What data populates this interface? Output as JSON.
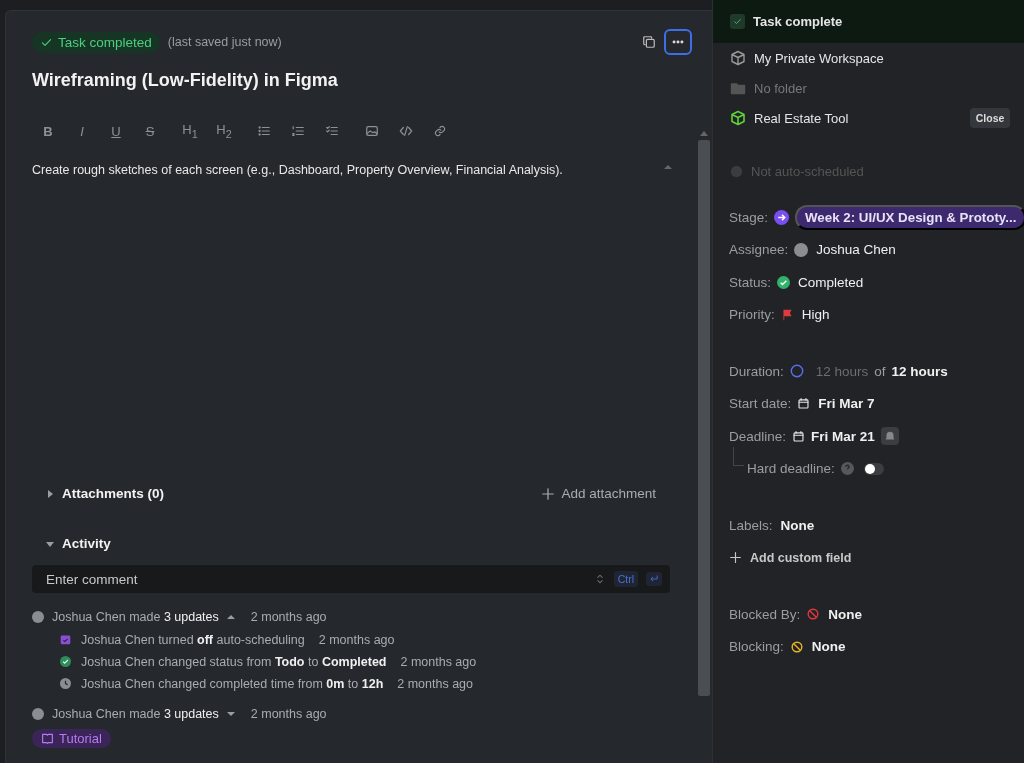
{
  "task": {
    "status_badge": "Task completed",
    "save_note": "(last saved just now)",
    "title": "Wireframing (Low-Fidelity) in Figma"
  },
  "toolbar": [
    {
      "kind": "bold",
      "label": "B"
    },
    {
      "kind": "italic",
      "label": "I"
    },
    {
      "kind": "underline",
      "label": "U"
    },
    {
      "kind": "strike",
      "label": "S"
    },
    {
      "kind": "heading",
      "label": "H$_{1}$"
    },
    {
      "kind": "heading",
      "label": "H$_{2}$"
    },
    {
      "kind": "bullets"
    },
    {
      "kind": "numbers"
    },
    {
      "kind": "checklist"
    },
    {
      "kind": "image"
    },
    {
      "kind": "code"
    },
    {
      "kind": "link"
    }
  ],
  "description": "Create rough sketches of each screen (e.g., Dashboard, Property Overview, Financial Analysis).",
  "sections": [
    {
      "title": "Attachments (0)",
      "expanded": false,
      "action": "Add attachment"
    },
    {
      "title": "Activity",
      "expanded": true
    }
  ],
  "comment": {
    "placeholder": "Enter comment",
    "shortcut": "Ctrl"
  },
  "activity": [
    {
      "summary": "Joshua Chen made **3 updates**",
      "expanded": true,
      "time": "2 months ago",
      "items": [
        {
          "kind": "schedule",
          "text": "Joshua Chen turned **off** auto-scheduling",
          "time": "2 months ago"
        },
        {
          "kind": "status",
          "text": "Joshua Chen changed status from **Todo** to **Completed**",
          "time": "2 months ago"
        },
        {
          "kind": "clock",
          "text": "Joshua Chen changed completed time from **0m** to **12h**",
          "time": "2 months ago"
        }
      ]
    },
    {
      "summary": "Joshua Chen made **3 updates**",
      "expanded": false,
      "time": "2 months ago"
    }
  ],
  "tutorial": "Tutorial",
  "side": {
    "complete": {
      "label": "Task complete",
      "checked": true
    },
    "location": [
      {
        "kind": "workspace",
        "label": "My Private Workspace",
        "muted": false
      },
      {
        "kind": "folder",
        "label": "No folder",
        "muted": true
      },
      {
        "kind": "project",
        "label": "Real Estate Tool",
        "muted": false,
        "action": "Close"
      }
    ],
    "auto_schedule": {
      "label": "Not auto-scheduled",
      "on": false
    },
    "groups": [
      [
        {
          "kind": "stage",
          "label": "Stage:",
          "value": "Week 2: UI/UX Design & Prototy..."
        },
        {
          "kind": "assignee",
          "label": "Assignee:",
          "value": "Joshua Chen"
        },
        {
          "kind": "status",
          "label": "Status:",
          "value": "Completed"
        },
        {
          "kind": "priority",
          "label": "Priority:",
          "value": "High"
        }
      ],
      [
        {
          "kind": "duration",
          "label": "Duration:",
          "done": "12 hours",
          "of": "of",
          "value": "12 hours"
        },
        {
          "kind": "start",
          "label": "Start date:",
          "value": "Fri Mar 7"
        },
        {
          "kind": "deadline",
          "label": "Deadline:",
          "value": "Fri Mar 21"
        },
        {
          "kind": "hard",
          "label": "Hard deadline:",
          "on": false
        }
      ],
      [
        {
          "kind": "labels",
          "label": "Labels:",
          "value": "None"
        },
        {
          "kind": "add",
          "label": "Add custom field"
        }
      ],
      [
        {
          "kind": "blocked",
          "label": "Blocked By:",
          "value": "None"
        },
        {
          "kind": "blocking",
          "label": "Blocking:",
          "value": "None"
        }
      ]
    ]
  }
}
